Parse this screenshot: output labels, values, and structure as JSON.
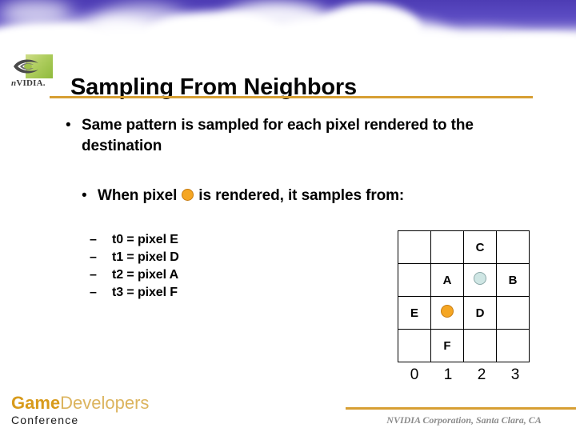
{
  "slide": {
    "title": "Sampling From Neighbors",
    "accent_gold": "#d79f33",
    "sky_purple": "#4d3cb4"
  },
  "branding": {
    "nvidia_wordmark_n": "n",
    "nvidia_wordmark_rest": "VIDIA.",
    "logo_icon": "nvidia-eye-icon",
    "logo_green_light": "#cfdd8a",
    "logo_green_dark": "#8fba3c"
  },
  "bullets": [
    {
      "marker": "•",
      "text": "Same pattern is sampled for each pixel rendered to the destination"
    },
    {
      "marker": "•",
      "text_before": "When pixel",
      "text_after": "is rendered, it samples from:"
    }
  ],
  "sub_bullets": [
    {
      "marker": "–",
      "text": "t0 = pixel E"
    },
    {
      "marker": "–",
      "text": "t1 = pixel D"
    },
    {
      "marker": "–",
      "text": "t2 = pixel A"
    },
    {
      "marker": "–",
      "text": "t3 = pixel F"
    }
  ],
  "grid": {
    "columns": 4,
    "rows": 4,
    "axis_labels": [
      "0",
      "1",
      "2",
      "3"
    ],
    "cells": [
      [
        {
          "label": ""
        },
        {
          "label": ""
        },
        {
          "label": "C"
        },
        {
          "label": ""
        }
      ],
      [
        {
          "label": ""
        },
        {
          "label": "A"
        },
        {
          "label": "",
          "dot": "blue"
        },
        {
          "label": "B"
        }
      ],
      [
        {
          "label": "E"
        },
        {
          "label": "",
          "dot": "orange"
        },
        {
          "label": "D"
        },
        {
          "label": ""
        }
      ],
      [
        {
          "label": ""
        },
        {
          "label": "F"
        },
        {
          "label": ""
        },
        {
          "label": ""
        }
      ]
    ],
    "dot_orange_fill": "#f5a623",
    "dot_orange_stroke": "#c87c10",
    "dot_blue_fill": "#cfe6e4",
    "dot_blue_stroke": "#8ba8a8"
  },
  "footer": {
    "gdc_game": "Game",
    "gdc_developers": "Developers",
    "gdc_conference": "Conference",
    "credit": "NVIDIA Corporation, Santa Clara, CA"
  }
}
